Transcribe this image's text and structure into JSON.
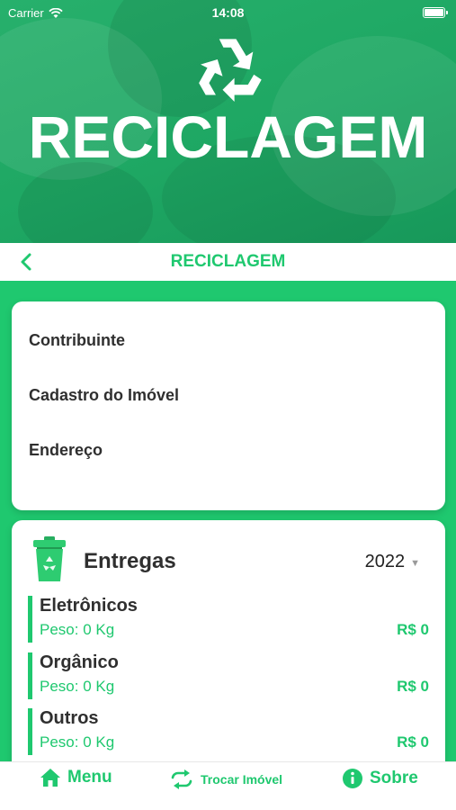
{
  "status_bar": {
    "carrier": "Carrier",
    "time": "14:08"
  },
  "hero": {
    "title": "RECICLAGEM",
    "logo_icon": "recycle-icon"
  },
  "navbar": {
    "title": "RECICLAGEM",
    "back_icon": "chevron-left-icon"
  },
  "info": {
    "contributor_label": "Contribuinte",
    "property_label": "Cadastro do Imóvel",
    "address_label": "Endereço"
  },
  "deliveries": {
    "title": "Entregas",
    "year": "2022",
    "items": [
      {
        "name": "Eletrônicos",
        "weight": "Peso: 0 Kg",
        "price": "R$ 0"
      },
      {
        "name": "Orgânico",
        "weight": "Peso: 0 Kg",
        "price": "R$ 0"
      },
      {
        "name": "Outros",
        "weight": "Peso: 0 Kg",
        "price": "R$ 0"
      }
    ]
  },
  "tabbar": {
    "menu_label": "Menu",
    "swap_label": "Trocar Imóvel",
    "about_label": "Sobre"
  },
  "colors": {
    "accent": "#1fc86f",
    "hero": "#1ea763",
    "text_dark": "#2f2f2f"
  }
}
